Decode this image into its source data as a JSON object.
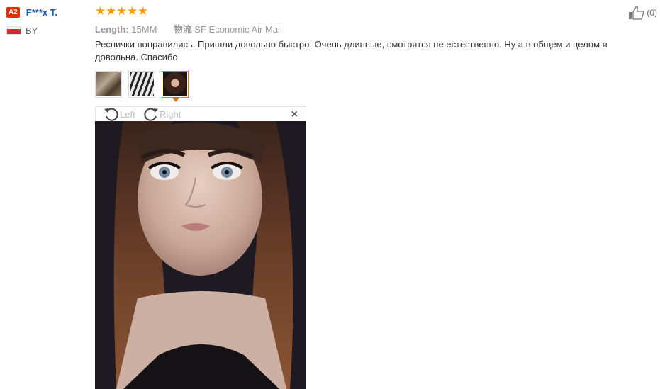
{
  "reviewer": {
    "level_badge": "A2",
    "name": "F***x T.",
    "country_code": "BY",
    "flag_colors": [
      "#f5f5f5",
      "#d22730"
    ]
  },
  "rating": {
    "stars": 5,
    "star_glyph": "★",
    "color": "#ff9a00"
  },
  "attributes": [
    {
      "key": "Length:",
      "value": "15MM"
    },
    {
      "key": "物流",
      "value": "SF Economic Air Mail"
    }
  ],
  "review_text": "Реснички понравились. Пришли довольно быстро. Очень длинные, смотрятся не естественно. Ну а в общем и целом я довольна. Спасибо",
  "helpful": {
    "icon": "thumbs-up-icon",
    "count_label": "(0)"
  },
  "thumbnails": [
    {
      "name": "lashes-box-photo",
      "active": false
    },
    {
      "name": "lashes-tray-photo",
      "active": false
    },
    {
      "name": "selfie-photo",
      "active": true
    }
  ],
  "viewer": {
    "rotate_left_label": "Left",
    "rotate_right_label": "Right",
    "close_label": "×"
  },
  "colors": {
    "accent": "#e67400",
    "link": "#1a5db5",
    "badge": "#e62e04"
  }
}
